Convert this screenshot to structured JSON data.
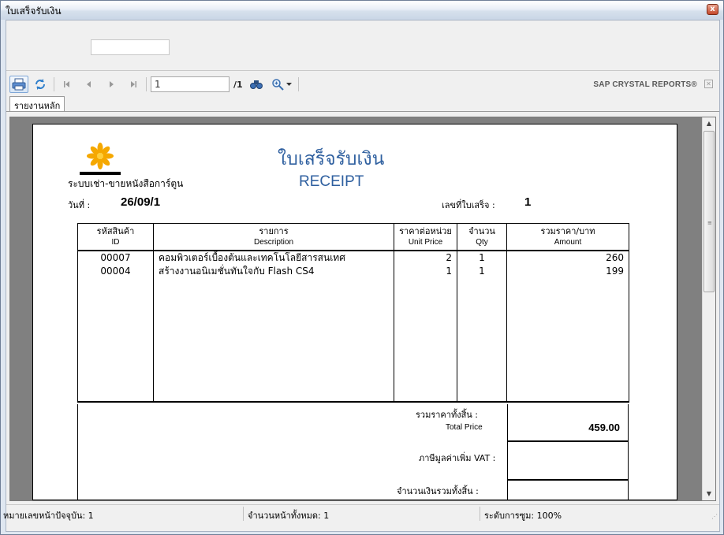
{
  "window": {
    "title": "ใบเสร็จรับเงิน",
    "close_label": "x"
  },
  "toolbar": {
    "icons": [
      "print-icon",
      "refresh-icon",
      "first-page-icon",
      "prev-page-icon",
      "next-page-icon",
      "last-page-icon",
      "find-icon",
      "zoom-icon"
    ],
    "page_current": "1",
    "page_total": "/1",
    "brand": "SAP CRYSTAL REPORTS®"
  },
  "tabs": {
    "main": "รายงานหลัก"
  },
  "report": {
    "company": "ระบบเช่า-ขายหนังสือการ์ตูน",
    "title_th": "ใบเสร็จรับเงิน",
    "title_en": "RECEIPT",
    "date_label": "วันที่ :",
    "date_value": "26/09/1",
    "receipt_no_label": "เลขที่ใบเสร็จ :",
    "receipt_no_value": "1",
    "columns": [
      {
        "th": "รหัสสินค้า",
        "en": "ID"
      },
      {
        "th": "รายการ",
        "en": "Description"
      },
      {
        "th": "ราคาต่อหน่วย",
        "en": "Unit Price"
      },
      {
        "th": "จำนวน",
        "en": "Qty"
      },
      {
        "th": "รวมราคา/บาท",
        "en": "Amount"
      }
    ],
    "rows": [
      {
        "id": "00007",
        "desc": "คอมพิวเตอร์เบื้องต้นและเทคโนโลยีสารสนเทศ",
        "price": "2",
        "qty": "1",
        "amount": "260"
      },
      {
        "id": "00004",
        "desc": "สร้างงานอนิเมชั่นทันใจกับ Flash CS4",
        "price": "1",
        "qty": "1",
        "amount": "199"
      }
    ],
    "total_label_th": "รวมราคาทั้งสิ้น :",
    "total_label_en": "Total Price",
    "total_value": "459.00",
    "vat_label": "ภาษีมูลค่าเพิ่ม VAT  :",
    "grand_label": "จำนวนเงินรวมทั้งสิ้น :"
  },
  "status": {
    "current_page": "หมายเลขหน้าปัจจุบัน: 1",
    "total_pages": "จำนวนหน้าทั้งหมด: 1",
    "zoom": "ระดับการซูม: 100%"
  }
}
